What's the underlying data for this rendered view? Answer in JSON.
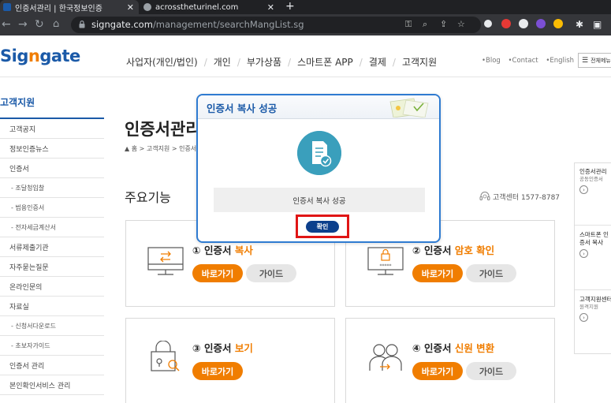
{
  "browser": {
    "tabs": [
      {
        "title": "인증서관리 | 한국정보인증",
        "active": true
      },
      {
        "title": "acrosstheturinel.com",
        "active": false
      }
    ],
    "url_host": "signgate.com",
    "url_path": "/management/searchMangList.sg"
  },
  "site": {
    "logo_a": "Sig",
    "logo_n": "n",
    "logo_b": "gate",
    "gnb": [
      "사업자(개인/법인)",
      "개인",
      "부가상품",
      "스마트폰 APP",
      "결제",
      "고객지원"
    ],
    "util": [
      "•Blog",
      "•Contact",
      "•English"
    ],
    "all_menu": "전체메뉴"
  },
  "sidebar": {
    "title": "고객지원",
    "items": [
      {
        "label": "고객공지",
        "sub": false
      },
      {
        "label": "정보인증뉴스",
        "sub": false
      },
      {
        "label": "인증서",
        "sub": false
      },
      {
        "label": "- 조달청입찰",
        "sub": true
      },
      {
        "label": "- 범용인증서",
        "sub": true
      },
      {
        "label": "- 전자세금계산서",
        "sub": true
      },
      {
        "label": "서류제출기관",
        "sub": false
      },
      {
        "label": "자주묻는질문",
        "sub": false
      },
      {
        "label": "온라인문의",
        "sub": false
      },
      {
        "label": "자료실",
        "sub": false
      },
      {
        "label": "- 신청서다운로드",
        "sub": true
      },
      {
        "label": "- 초보자가이드",
        "sub": true
      },
      {
        "label": "인증서 관리",
        "sub": false
      },
      {
        "label": "본인확인서비스 관리",
        "sub": false
      }
    ]
  },
  "main": {
    "title": "인증서관리",
    "breadcrumb": "홈 > 고객지원 > 인증서",
    "section_title": "주요기능",
    "customer_center": "고객센터 1577-8787",
    "go_label": "바로가기",
    "guide_label": "가이드",
    "cards": [
      {
        "num": "①",
        "title": "인증서",
        "em": "복사",
        "guide": true
      },
      {
        "num": "②",
        "title": "인증서",
        "em": "암호 확인",
        "guide": true
      },
      {
        "num": "③",
        "title": "인증서",
        "em": "보기",
        "guide": false
      },
      {
        "num": "④",
        "title": "인증서",
        "em": "신원 변환",
        "guide": true
      }
    ]
  },
  "right_banners": [
    {
      "title": "인증서관리",
      "sub": "공동인증서"
    },
    {
      "title": "스마트폰 인증서 복사",
      "sub": ""
    },
    {
      "title": "고객지원센터",
      "sub": "원격지원"
    }
  ],
  "modal": {
    "title": "인증서 복사 성공",
    "message": "인증서 복사 성공",
    "ok": "확인"
  },
  "colors": {
    "brand_blue": "#1b5aa8",
    "accent_orange": "#f07d00",
    "modal_border": "#2f7bd1",
    "ok_button": "#0c3f8c",
    "highlight_red": "#e01515",
    "icon_teal": "#3a9fbc"
  }
}
